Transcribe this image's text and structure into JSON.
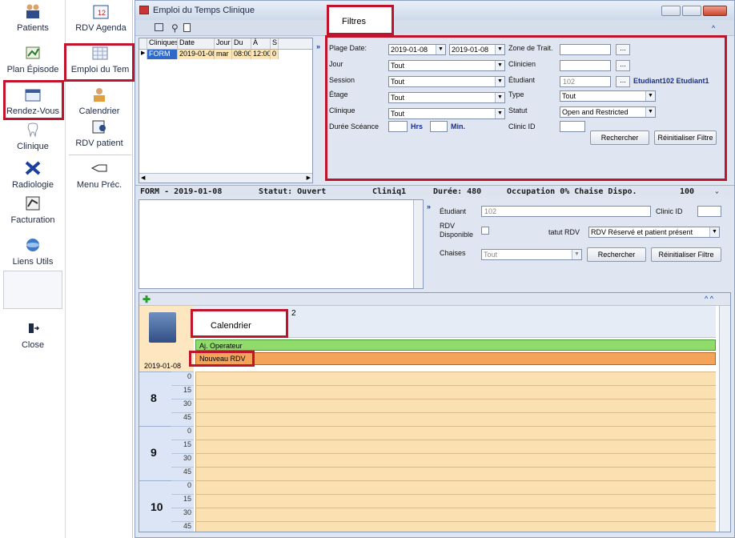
{
  "nav_primary": [
    {
      "key": "patients",
      "label": "Patients",
      "icon": "people-icon"
    },
    {
      "key": "plan",
      "label": "Plan Épisode",
      "icon": "plan-icon"
    },
    {
      "key": "rdv",
      "label": "Rendez-Vous",
      "icon": "calendar-icon"
    },
    {
      "key": "clinique",
      "label": "Clinique",
      "icon": "tooth-icon"
    },
    {
      "key": "radiologie",
      "label": "Radiologie",
      "icon": "xray-icon"
    },
    {
      "key": "facturation",
      "label": "Facturation",
      "icon": "invoice-icon"
    },
    {
      "key": "liens",
      "label": "Liens Utils",
      "icon": "globe-icon"
    },
    {
      "key": "close",
      "label": "Close",
      "icon": "exit-icon"
    }
  ],
  "nav_secondary": [
    {
      "key": "rdv_agenda",
      "label": "RDV Agenda",
      "icon": "agenda-icon"
    },
    {
      "key": "emploi",
      "label": "Emploi du Tem",
      "icon": "grid-calendar-icon"
    },
    {
      "key": "calendrier",
      "label": "Calendrier",
      "icon": "person-calendar-icon"
    },
    {
      "key": "rdv_patient",
      "label": "RDV patient",
      "icon": "patient-rdv-icon"
    },
    {
      "key": "menu_prec",
      "label": "Menu Préc.",
      "icon": "back-hand-icon"
    }
  ],
  "window": {
    "title": "Emploi du Temps Clinique"
  },
  "callouts": {
    "filtres": "Filtres",
    "calendrier": "Calendrier"
  },
  "grid": {
    "headers": [
      "Cliniques",
      "Date",
      "Jour",
      "Du",
      "À",
      "S"
    ],
    "row": [
      "FORM",
      "2019-01-08",
      "mar",
      "08:00",
      "12:00",
      "0"
    ]
  },
  "filters": {
    "plage_date_label": "Plage Date:",
    "date_from": "2019-01-08",
    "date_to": "2019-01-08",
    "zone_label": "Zone de Trait.",
    "jour_label": "Jour",
    "jour_value": "Tout",
    "clinicien_label": "Clinicien",
    "session_label": "Session",
    "session_value": "Tout",
    "etudiant_label": "Étudiant",
    "etudiant_value": "102",
    "etudiant_name": "Etudiant102 Etudiant1",
    "etage_label": "Étage",
    "etage_value": "Tout",
    "type_label": "Type",
    "type_value": "Tout",
    "clinique_label": "Clinique",
    "clinique_value": "Tout",
    "statut_label": "Statut",
    "statut_value": "Open and Restricted",
    "duree_label": "Durée Scéance",
    "hrs_label": "Hrs",
    "min_label": "Min.",
    "clinicid_label": "Clinic ID",
    "rechercher": "Rechercher",
    "reinit": "Réinitialiser Filtre"
  },
  "summary": {
    "form": "FORM - 2019-01-08",
    "statut": "Statut: Ouvert",
    "clinique": "Cliniq1",
    "duree": "Durée: 480",
    "occupation": "Occupation  0% Chaise Dispo.",
    "chaise": "100"
  },
  "detail": {
    "etudiant_label": "Étudiant",
    "etudiant_value": "102",
    "clinicid_label": "Clinic ID",
    "rdv_dispo_label": "RDV Disponible",
    "statut_rdv_label": "tatut RDV",
    "statut_rdv_value": "RDV Réservé et patient présent",
    "chaises_label": "Chaises",
    "chaises_value": "Tout",
    "rechercher": "Rechercher",
    "reinit": "Réinitialiser Filtre"
  },
  "calendar": {
    "date": "2019-01-08",
    "col_header": "2",
    "ajout": "Aj. Operateur",
    "nouveau": "Nouveau RDV",
    "hours": [
      "8",
      "9",
      "10"
    ],
    "minutes": [
      "0",
      "15",
      "30",
      "45"
    ]
  },
  "colors": {
    "accent_red": "#c0142c",
    "slot": "#fbe0b2",
    "ajout": "#8fdc6a",
    "nouveau": "#f3a35a"
  }
}
